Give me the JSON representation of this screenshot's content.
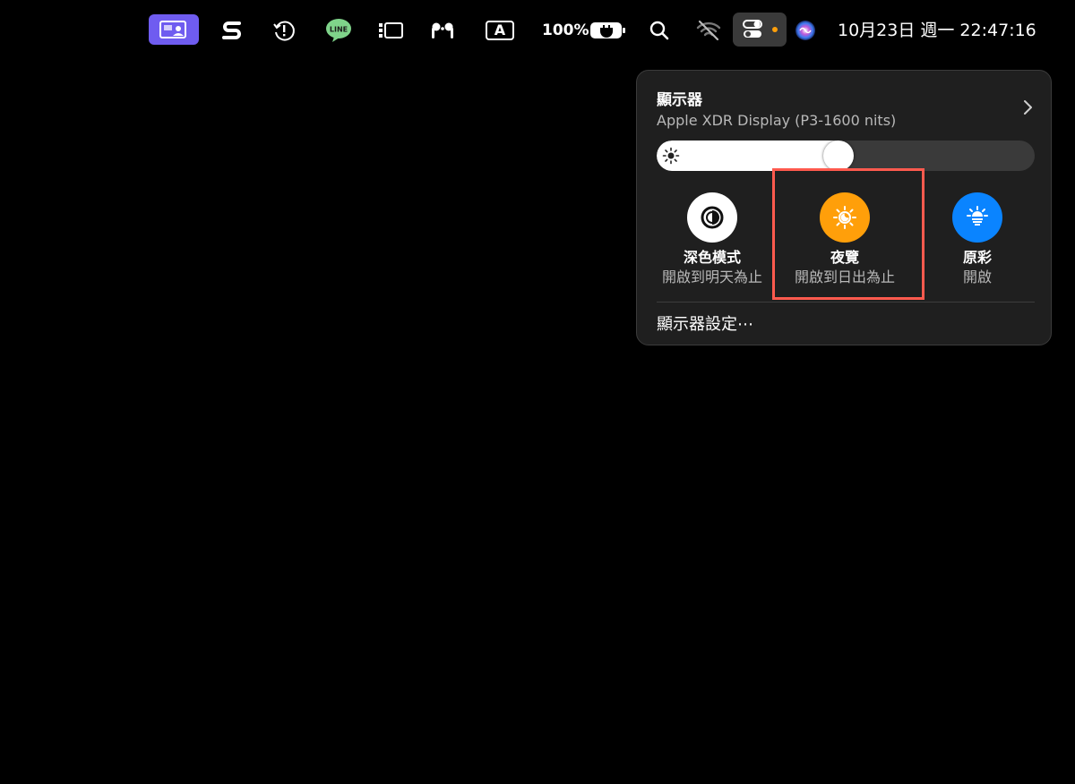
{
  "menubar": {
    "icons": [
      "screen-share-icon",
      "s-app-icon",
      "time-machine-icon",
      "line-app-icon",
      "stage-manager-icon",
      "airpods-icon",
      "input-source-icon",
      "battery-icon",
      "search-icon",
      "wifi-off-icon",
      "control-center-icon",
      "siri-icon"
    ],
    "line_label": "LINE",
    "input_source": "A",
    "battery_percent": "100%",
    "datetime": "10月23日 週一  22:47:16"
  },
  "display_panel": {
    "title": "顯示器",
    "subtitle": "Apple XDR Display (P3-1600 nits)",
    "brightness": 0.48,
    "modes": [
      {
        "label": "深色模式",
        "sub": "開啟到明天為止",
        "icon": "dark-mode-icon",
        "color": "#ffffff"
      },
      {
        "label": "夜覽",
        "sub": "開啟到日出為止",
        "icon": "night-shift-icon",
        "color": "#ff9f0a"
      },
      {
        "label": "原彩",
        "sub": "開啟",
        "icon": "true-tone-icon",
        "color": "#0a84ff"
      }
    ],
    "settings_label": "顯示器設定⋯"
  },
  "colors": {
    "accent_purple": "#6f5cf0",
    "night_shift_orange": "#ff9f0a",
    "true_tone_blue": "#0a84ff",
    "highlight_red": "#ff5a4e"
  }
}
